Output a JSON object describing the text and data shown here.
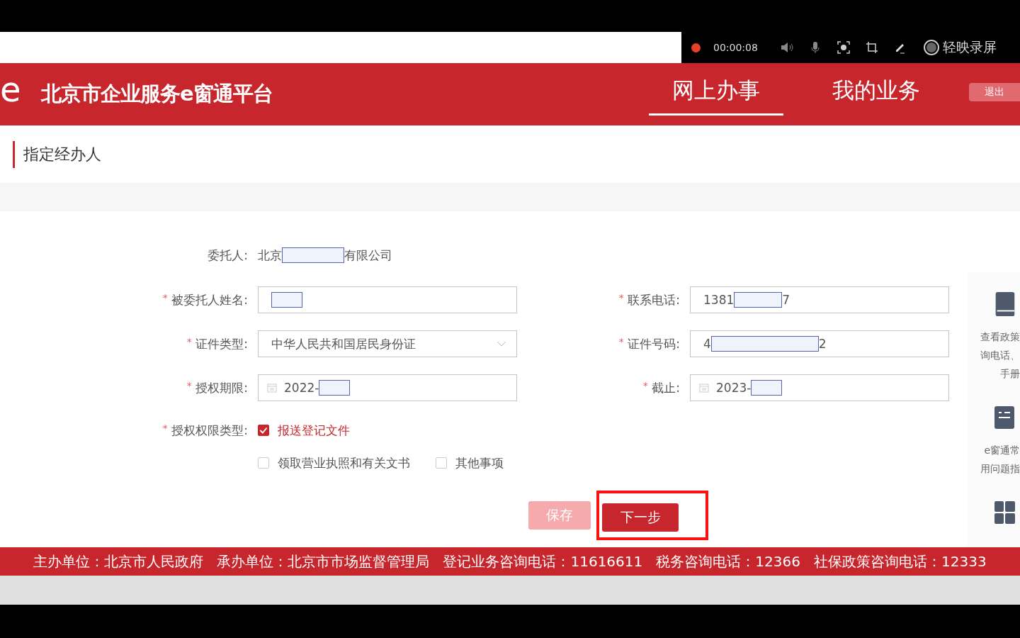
{
  "recorder": {
    "time": "00:00:08",
    "app_name": "轻映录屏"
  },
  "header": {
    "logo": "e",
    "title": "北京市企业服务e窗通平台",
    "nav": [
      {
        "label": "网上办事",
        "selected": true
      },
      {
        "label": "我的业务",
        "selected": false
      }
    ],
    "logout": "退出"
  },
  "page_title": "指定经办人",
  "principal": {
    "label": "委托人:",
    "prefix": "北京",
    "suffix": "有限公司"
  },
  "fields": [
    {
      "label": "被委托人姓名:",
      "required_mark": "*",
      "kind": "text"
    },
    {
      "label": "联系电话:",
      "required_mark": "*",
      "kind": "text",
      "prefix": "1381",
      "suffix": "7"
    },
    {
      "label": "证件类型:",
      "required_mark": "*",
      "kind": "select",
      "prefix": "中华人民共和国居民身份证"
    },
    {
      "label": "证件号码:",
      "required_mark": "*",
      "kind": "text",
      "prefix": "4",
      "suffix": "2"
    },
    {
      "label": "授权期限:",
      "required_mark": "*",
      "kind": "date",
      "prefix": "2022-"
    },
    {
      "label": "截止:",
      "required_mark": "*",
      "kind": "date",
      "prefix": "2023-"
    }
  ],
  "authority": {
    "label": "授权权限类型:",
    "required_mark": "*",
    "options": [
      {
        "label": "报送登记文件",
        "checked": true
      },
      {
        "label": "领取营业执照和有关文书",
        "checked": false
      },
      {
        "label": "其他事项",
        "checked": false
      }
    ]
  },
  "buttons": [
    {
      "label": "保存",
      "disabled": true
    },
    {
      "label": "下一步",
      "disabled": false
    }
  ],
  "side_panel": [
    {
      "kind": "book",
      "lines": [
        "查看政策",
        "询电话、",
        "手册"
      ]
    },
    {
      "kind": "doc",
      "lines": [
        "e窗通常",
        "用问题指"
      ]
    },
    {
      "kind": "grid"
    }
  ],
  "footer": "主办单位：北京市人民政府   承办单位：北京市市场监督管理局   登记业务咨询电话：11616611   税务咨询电话：12366   社保政策咨询电话：12333"
}
